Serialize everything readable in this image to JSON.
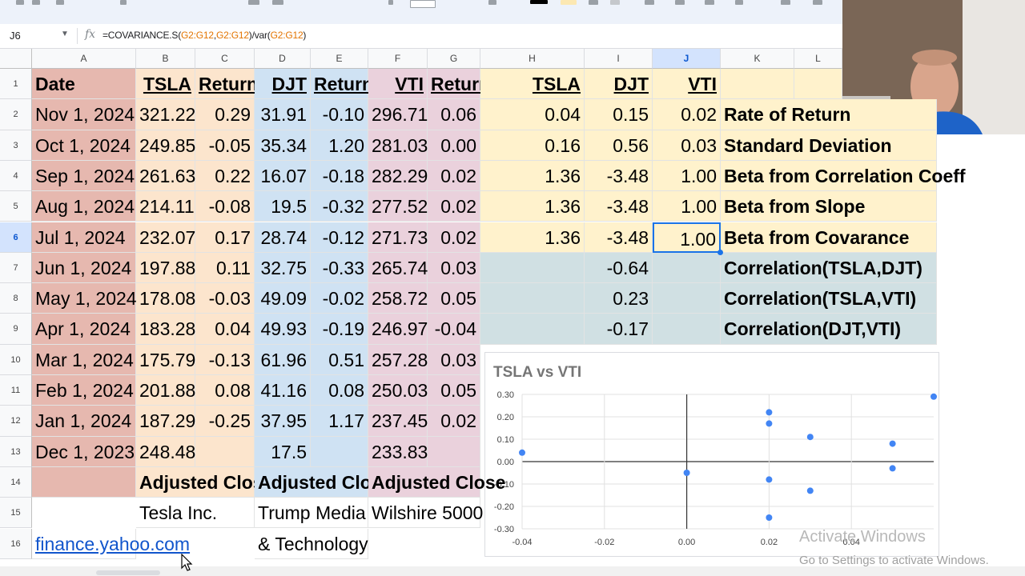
{
  "formula_bar": {
    "cell_ref": "J6",
    "fx": "fx",
    "parts": [
      {
        "t": "=COVARIANCE.S(",
        "ref": false
      },
      {
        "t": "G2:G12",
        "ref": true
      },
      {
        "t": ",",
        "ref": false
      },
      {
        "t": "G2:G12",
        "ref": true
      },
      {
        "t": ")/var(",
        "ref": false
      },
      {
        "t": "G2:G12",
        "ref": true
      },
      {
        "t": ")",
        "ref": false
      }
    ]
  },
  "columns": [
    "A",
    "B",
    "C",
    "D",
    "E",
    "F",
    "G",
    "H",
    "I",
    "J",
    "K",
    "L"
  ],
  "rows": [
    "1",
    "2",
    "3",
    "4",
    "5",
    "6",
    "7",
    "8",
    "9",
    "10",
    "11",
    "12",
    "13",
    "14",
    "15",
    "16"
  ],
  "selected": {
    "column": "J",
    "row": "6"
  },
  "colors": {
    "date_fill": "#e6b8af",
    "tsla_fill": "#fce5cd",
    "djt_fill": "#cfe2f3",
    "vti_fill": "#ead1dc",
    "summary_fill": "#fff2cc",
    "corr_fill": "#d0e0e3",
    "accent": "#1a73e8",
    "dot": "#4285f4"
  },
  "header": {
    "date": "Date",
    "tsla": "TSLA",
    "tsla_ret": "Return",
    "djt": "DJT",
    "djt_ret": "Return",
    "vti": "VTI",
    "vti_ret": "Return",
    "h": "TSLA",
    "i": "DJT",
    "j": "VTI"
  },
  "data_rows": [
    {
      "date": "Nov 1, 2024",
      "tsla": "321.22",
      "tsla_ret": "0.29",
      "djt": "31.91",
      "djt_ret": "-0.10",
      "vti": "296.71",
      "vti_ret": "0.06"
    },
    {
      "date": "Oct 1, 2024",
      "tsla": "249.85",
      "tsla_ret": "-0.05",
      "djt": "35.34",
      "djt_ret": "1.20",
      "vti": "281.03",
      "vti_ret": "0.00"
    },
    {
      "date": "Sep 1, 2024",
      "tsla": "261.63",
      "tsla_ret": "0.22",
      "djt": "16.07",
      "djt_ret": "-0.18",
      "vti": "282.29",
      "vti_ret": "0.02"
    },
    {
      "date": "Aug 1, 2024",
      "tsla": "214.11",
      "tsla_ret": "-0.08",
      "djt": "19.5",
      "djt_ret": "-0.32",
      "vti": "277.52",
      "vti_ret": "0.02"
    },
    {
      "date": "Jul 1, 2024",
      "tsla": "232.07",
      "tsla_ret": "0.17",
      "djt": "28.74",
      "djt_ret": "-0.12",
      "vti": "271.73",
      "vti_ret": "0.02"
    },
    {
      "date": "Jun 1, 2024",
      "tsla": "197.88",
      "tsla_ret": "0.11",
      "djt": "32.75",
      "djt_ret": "-0.33",
      "vti": "265.74",
      "vti_ret": "0.03"
    },
    {
      "date": "May 1, 2024",
      "tsla": "178.08",
      "tsla_ret": "-0.03",
      "djt": "49.09",
      "djt_ret": "-0.02",
      "vti": "258.72",
      "vti_ret": "0.05"
    },
    {
      "date": "Apr 1, 2024",
      "tsla": "183.28",
      "tsla_ret": "0.04",
      "djt": "49.93",
      "djt_ret": "-0.19",
      "vti": "246.97",
      "vti_ret": "-0.04"
    },
    {
      "date": "Mar 1, 2024",
      "tsla": "175.79",
      "tsla_ret": "-0.13",
      "djt": "61.96",
      "djt_ret": "0.51",
      "vti": "257.28",
      "vti_ret": "0.03"
    },
    {
      "date": "Feb 1, 2024",
      "tsla": "201.88",
      "tsla_ret": "0.08",
      "djt": "41.16",
      "djt_ret": "0.08",
      "vti": "250.03",
      "vti_ret": "0.05"
    },
    {
      "date": "Jan 1, 2024",
      "tsla": "187.29",
      "tsla_ret": "-0.25",
      "djt": "37.95",
      "djt_ret": "1.17",
      "vti": "237.45",
      "vti_ret": "0.02"
    },
    {
      "date": "Dec 1, 2023",
      "tsla": "248.48",
      "tsla_ret": "",
      "djt": "17.5",
      "djt_ret": "",
      "vti": "233.83",
      "vti_ret": ""
    }
  ],
  "summary": [
    {
      "h": "0.04",
      "i": "0.15",
      "j": "0.02",
      "label": "Rate of Return"
    },
    {
      "h": "0.16",
      "i": "0.56",
      "j": "0.03",
      "label": "Standard Deviation"
    },
    {
      "h": "1.36",
      "i": "-3.48",
      "j": "1.00",
      "label": "Beta from Correlation Coeff"
    },
    {
      "h": "1.36",
      "i": "-3.48",
      "j": "1.00",
      "label": "Beta from Slope"
    },
    {
      "h": "1.36",
      "i": "-3.48",
      "j": "1.00",
      "label": "Beta from Covarance"
    }
  ],
  "correlations": [
    {
      "value": "-0.64",
      "label": "Correlation(TSLA,DJT)"
    },
    {
      "value": "0.23",
      "label": "Correlation(TSLA,VTI)"
    },
    {
      "value": "-0.17",
      "label": "Correlation(DJT,VTI)"
    }
  ],
  "footer": {
    "tsla_note": "Adjusted Close",
    "djt_note": "Adjusted Close",
    "vti_note": "Adjusted Close",
    "tsla_name": "Tesla Inc.",
    "djt_name_1": "Trump Media",
    "djt_name_2": "& Technology",
    "vti_name": "Wilshire 5000",
    "source": "finance.yahoo.com"
  },
  "chart_data": {
    "type": "scatter",
    "title": "TSLA vs VTI",
    "xlim": [
      -0.04,
      0.06
    ],
    "ylim": [
      -0.3,
      0.3
    ],
    "xticks": [
      "-0.04",
      "-0.02",
      "0.00",
      "0.02",
      "0.04"
    ],
    "yticks": [
      "0.30",
      "0.20",
      "0.10",
      "0.00",
      "-0.10",
      "-0.20",
      "-0.30"
    ],
    "grid": true,
    "points": [
      {
        "x": 0.06,
        "y": 0.29
      },
      {
        "x": 0.0,
        "y": -0.05
      },
      {
        "x": 0.02,
        "y": 0.22
      },
      {
        "x": 0.02,
        "y": -0.08
      },
      {
        "x": 0.02,
        "y": 0.17
      },
      {
        "x": 0.03,
        "y": 0.11
      },
      {
        "x": 0.05,
        "y": -0.03
      },
      {
        "x": -0.04,
        "y": 0.04
      },
      {
        "x": 0.03,
        "y": -0.13
      },
      {
        "x": 0.05,
        "y": 0.08
      },
      {
        "x": 0.02,
        "y": -0.25
      }
    ]
  },
  "watermark": {
    "line1": "Activate Windows",
    "line2": "Go to Settings to activate Windows."
  }
}
